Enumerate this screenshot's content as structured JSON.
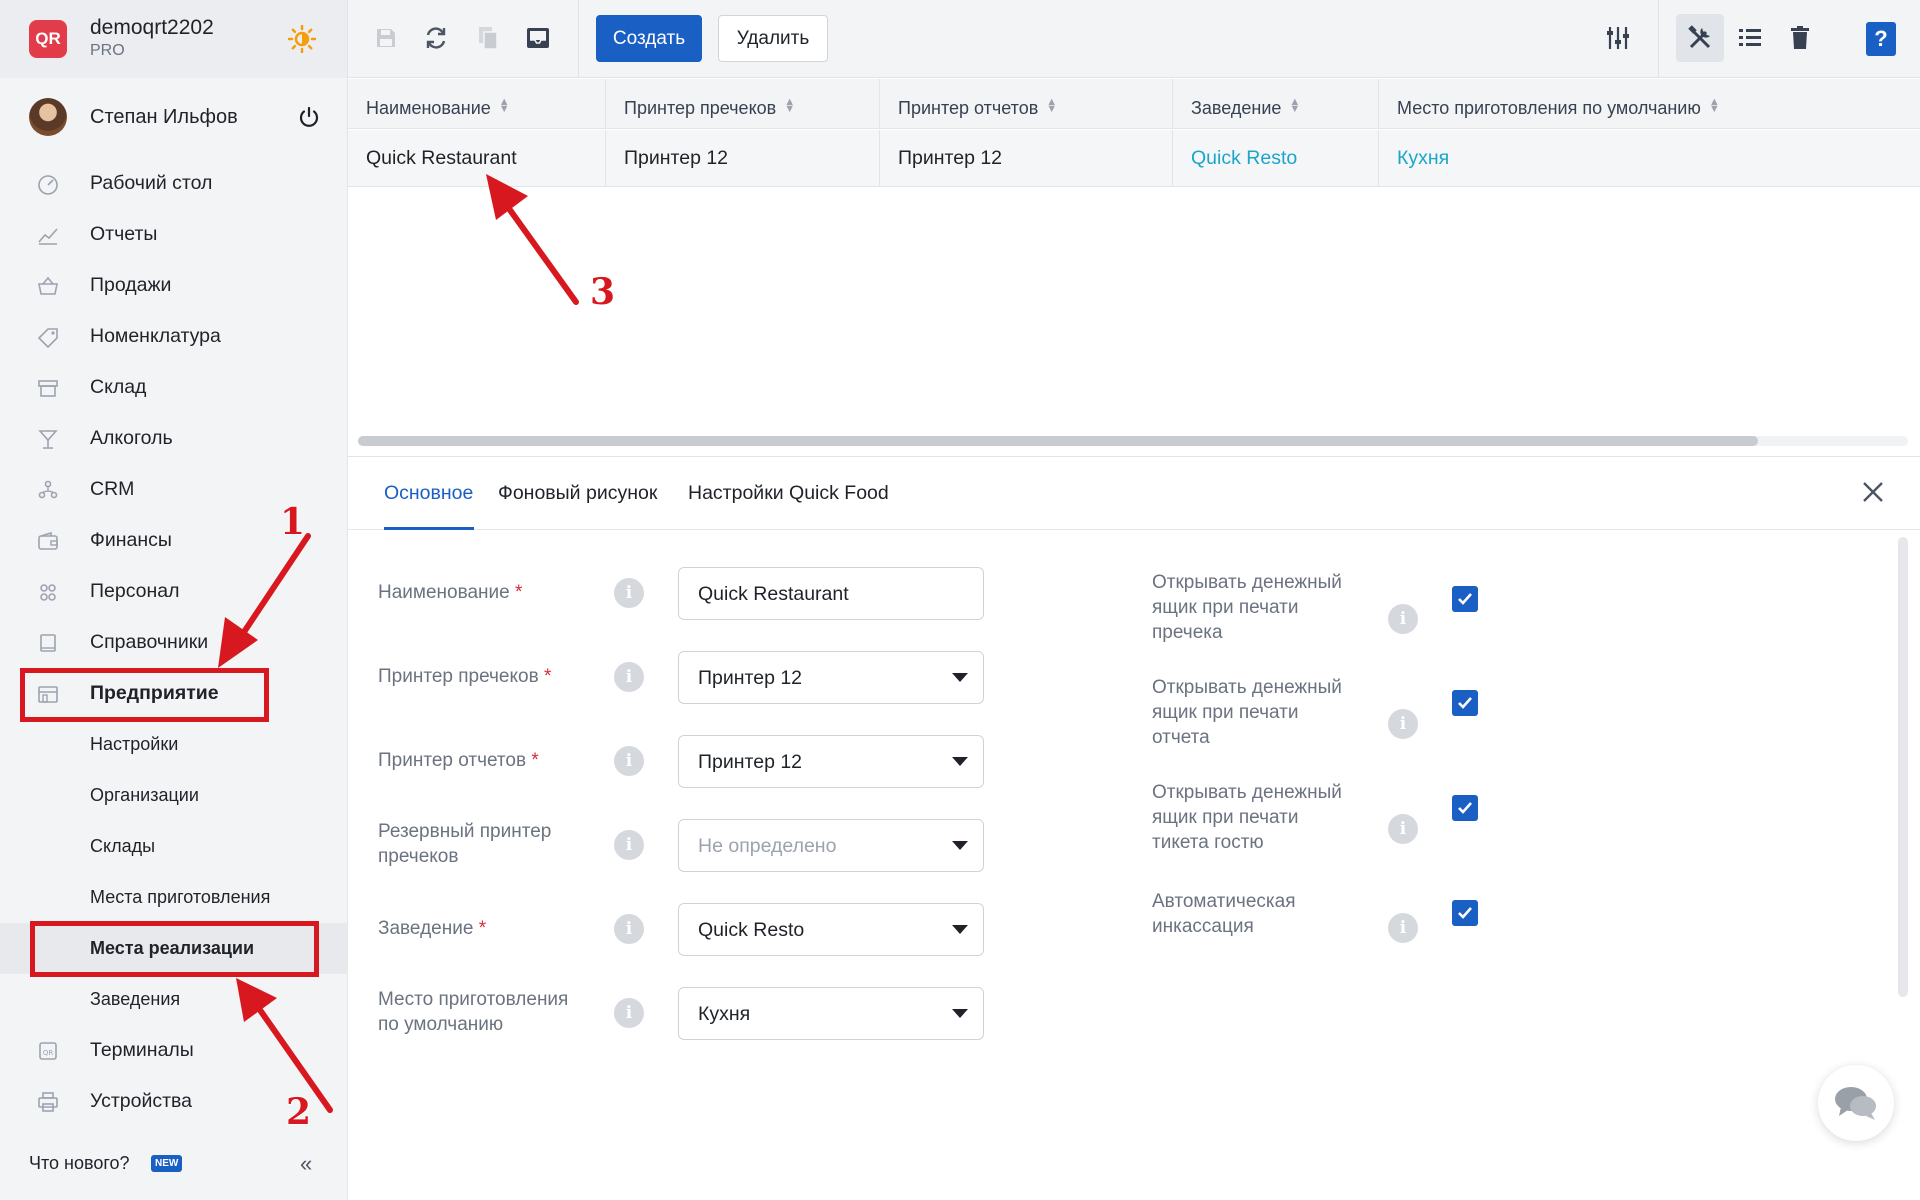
{
  "header": {
    "account": "demoqrt2202",
    "plan": "PRO",
    "logo": "QR"
  },
  "user": {
    "name": "Степан Ильфов"
  },
  "nav": [
    {
      "label": "Рабочий стол",
      "icon": "dashboard-icon"
    },
    {
      "label": "Отчеты",
      "icon": "chart-icon"
    },
    {
      "label": "Продажи",
      "icon": "basket-icon"
    },
    {
      "label": "Номенклатура",
      "icon": "tag-icon"
    },
    {
      "label": "Склад",
      "icon": "box-icon"
    },
    {
      "label": "Алкоголь",
      "icon": "glass-icon"
    },
    {
      "label": "CRM",
      "icon": "people-icon"
    },
    {
      "label": "Финансы",
      "icon": "wallet-icon"
    },
    {
      "label": "Персонал",
      "icon": "staff-icon"
    },
    {
      "label": "Справочники",
      "icon": "book-icon"
    },
    {
      "label": "Предприятие",
      "icon": "store-icon"
    }
  ],
  "subnav": [
    "Настройки",
    "Организации",
    "Склады",
    "Места приготовления",
    "Места реализации",
    "Заведения"
  ],
  "nav_bottom": [
    {
      "label": "Терминалы",
      "icon": "terminal-icon"
    },
    {
      "label": "Устройства",
      "icon": "printer-icon"
    }
  ],
  "footer": {
    "whats_new": "Что нового?",
    "badge": "NEW",
    "collapse": "«"
  },
  "toolbar": {
    "create": "Создать",
    "delete": "Удалить",
    "help": "?"
  },
  "grid": {
    "columns": [
      "Наименование",
      "Принтер пречеков",
      "Принтер отчетов",
      "Заведение",
      "Место приготовления по умолчанию"
    ],
    "rows": [
      [
        "Quick Restaurant",
        "Принтер 12",
        "Принтер 12",
        "Quick Resto",
        "Кухня"
      ]
    ]
  },
  "tabs": [
    "Основное",
    "Фоновый рисунок",
    "Настройки Quick Food"
  ],
  "form": {
    "name_label": "Наименование",
    "name_value": "Quick Restaurant",
    "printer_prechecks_label": "Принтер пречеков",
    "printer_prechecks_value": "Принтер 12",
    "printer_reports_label": "Принтер отчетов",
    "printer_reports_value": "Принтер 12",
    "backup_printer_label_1": "Резервный принтер",
    "backup_printer_label_2": "пречеков",
    "backup_printer_placeholder": "Не определено",
    "venue_label": "Заведение",
    "venue_value": "Quick Resto",
    "default_place_label_1": "Место приготовления",
    "default_place_label_2": "по умолчанию",
    "default_place_value": "Кухня",
    "required_mark": "*",
    "info": "i"
  },
  "checks": [
    {
      "lines": [
        "Открывать денежный",
        "ящик при печати",
        "пречека"
      ],
      "checked": true
    },
    {
      "lines": [
        "Открывать денежный",
        "ящик при печати",
        "отчета"
      ],
      "checked": true
    },
    {
      "lines": [
        "Открывать денежный",
        "ящик при печати",
        "тикета гостю"
      ],
      "checked": true
    },
    {
      "lines": [
        "Автоматическая",
        "инкассация"
      ],
      "checked": true
    }
  ],
  "annotations": [
    "1",
    "2",
    "3"
  ],
  "colors": {
    "accent": "#1a5fc4",
    "link": "#1ba6c9",
    "annotation": "#d7181f",
    "logo": "#e23b4a"
  }
}
